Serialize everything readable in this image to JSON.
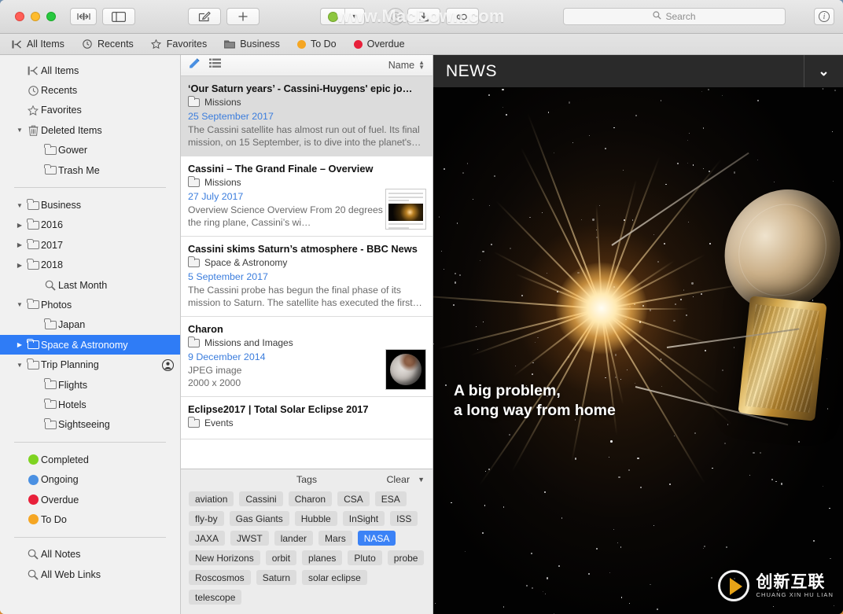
{
  "window": {
    "traffic_lights": [
      "close",
      "minimize",
      "zoom"
    ],
    "toolbar": {
      "sidebar_toggle_label": "›|‹",
      "panes_toggle_label": "▯▯",
      "compose_label": "✎",
      "add_label": "+",
      "status_dot_color": "#8dc63f",
      "status_chevron": "⌄",
      "clock_icon": "clock-icon",
      "download_icon": "download-icon",
      "link_icon": "link-icon",
      "search_placeholder": "Search",
      "info_label": "i"
    },
    "watermark_top": "www.MacDown.com",
    "watermark_logo": {
      "chinese": "创新互联",
      "pinyin": "CHUANG XIN HU LIAN"
    }
  },
  "favorites_bar": [
    {
      "label": "All Items",
      "icon": "all-items-icon",
      "color": null
    },
    {
      "label": "Recents",
      "icon": "clock-icon",
      "color": null
    },
    {
      "label": "Favorites",
      "icon": "star-icon",
      "color": null
    },
    {
      "label": "Business",
      "icon": "folder-icon",
      "color": null
    },
    {
      "label": "To Do",
      "icon": "dot-icon",
      "color": "#f5a623"
    },
    {
      "label": "Overdue",
      "icon": "dot-icon",
      "color": "#e8203a"
    }
  ],
  "sidebar": {
    "groups": [
      {
        "items": [
          {
            "label": "All Items",
            "icon": "all-items-icon",
            "indent": 1,
            "twisty": "",
            "selected": false
          },
          {
            "label": "Recents",
            "icon": "clock-icon",
            "indent": 1,
            "twisty": "",
            "selected": false
          },
          {
            "label": "Favorites",
            "icon": "star-icon",
            "indent": 1,
            "twisty": "",
            "selected": false
          },
          {
            "label": "Deleted Items",
            "icon": "trash-icon",
            "indent": 0,
            "twisty": "▼",
            "selected": false
          },
          {
            "label": "Gower",
            "icon": "folder-icon",
            "indent": 2,
            "twisty": "",
            "selected": false
          },
          {
            "label": "Trash Me",
            "icon": "folder-icon",
            "indent": 2,
            "twisty": "",
            "selected": false
          }
        ]
      },
      {
        "items": [
          {
            "label": "Business",
            "icon": "folder-icon",
            "indent": 0,
            "twisty": "▼",
            "selected": false
          },
          {
            "label": "2016",
            "icon": "folder-icon",
            "indent": 1,
            "twisty": "▶",
            "selected": false
          },
          {
            "label": "2017",
            "icon": "folder-icon",
            "indent": 1,
            "twisty": "▶",
            "selected": false
          },
          {
            "label": "2018",
            "icon": "folder-icon",
            "indent": 1,
            "twisty": "▶",
            "selected": false
          },
          {
            "label": "Last Month",
            "icon": "smart-search-icon",
            "indent": 2,
            "twisty": "",
            "selected": false
          },
          {
            "label": "Photos",
            "icon": "folder-icon",
            "indent": 0,
            "twisty": "▼",
            "selected": false
          },
          {
            "label": "Japan",
            "icon": "folder-icon",
            "indent": 2,
            "twisty": "",
            "selected": false
          },
          {
            "label": "Space & Astronomy",
            "icon": "folder-icon",
            "indent": 0,
            "twisty": "▶",
            "selected": true
          },
          {
            "label": "Trip Planning",
            "icon": "folder-icon",
            "indent": 0,
            "twisty": "▼",
            "selected": false,
            "trailing_icon": "shared-user-icon"
          },
          {
            "label": "Flights",
            "icon": "folder-icon",
            "indent": 2,
            "twisty": "",
            "selected": false
          },
          {
            "label": "Hotels",
            "icon": "folder-icon",
            "indent": 2,
            "twisty": "",
            "selected": false
          },
          {
            "label": "Sightseeing",
            "icon": "folder-icon",
            "indent": 2,
            "twisty": "",
            "selected": false
          }
        ]
      },
      {
        "items": [
          {
            "label": "Completed",
            "icon": "dot-icon",
            "color": "#7ed321",
            "indent": 1,
            "twisty": "",
            "selected": false
          },
          {
            "label": "Ongoing",
            "icon": "dot-icon",
            "color": "#4a90e2",
            "indent": 1,
            "twisty": "",
            "selected": false
          },
          {
            "label": "Overdue",
            "icon": "dot-icon",
            "color": "#e8203a",
            "indent": 1,
            "twisty": "",
            "selected": false
          },
          {
            "label": "To Do",
            "icon": "dot-icon",
            "color": "#f5a623",
            "indent": 1,
            "twisty": "",
            "selected": false
          }
        ]
      },
      {
        "items": [
          {
            "label": "All Notes",
            "icon": "smart-search-icon",
            "indent": 1,
            "twisty": "",
            "selected": false
          },
          {
            "label": "All Web Links",
            "icon": "smart-search-icon",
            "indent": 1,
            "twisty": "",
            "selected": false
          }
        ]
      }
    ]
  },
  "list": {
    "header": {
      "tag_icon": "tag-edit-icon",
      "view_icon": "list-view-icon",
      "sort_label": "Name",
      "sort_icon": "sort-arrows-icon"
    },
    "items": [
      {
        "title": "‘Our Saturn years’ - Cassini-Huygens' epic jo…",
        "location": "Missions",
        "date": "25 September 2017",
        "snippet": "The Cassini satellite has almost run out of fuel. Its final mission, on 15 September, is to dive into the planet's…",
        "selected": true,
        "thumb": "none"
      },
      {
        "title": "Cassini – The Grand Finale – Overview",
        "location": "Missions",
        "date": "27 July 2017",
        "snippet": "Overview Science Overview From 20 degrees above the ring plane, Cassini’s wi…",
        "selected": false,
        "thumb": "document"
      },
      {
        "title": "Cassini skims Saturn’s atmosphere - BBC News",
        "location": "Space & Astronomy",
        "date": "5 September 2017",
        "snippet": "The Cassini probe has begun the final phase of its mission to Saturn. The satellite has executed the first…",
        "selected": false,
        "thumb": "none"
      },
      {
        "title": "Charon",
        "location": "Missions and Images",
        "date": "9 December 2014",
        "meta_type": "JPEG image",
        "meta_size": "2000 x 2000",
        "selected": false,
        "thumb": "image"
      },
      {
        "title": "Eclipse2017 | Total Solar Eclipse 2017",
        "location": "Events",
        "selected": false,
        "thumb": "none"
      }
    ]
  },
  "tags_panel": {
    "title": "Tags",
    "clear_label": "Clear",
    "collapse_icon": "chevron-down-icon",
    "tags": [
      {
        "label": "aviation",
        "selected": false
      },
      {
        "label": "Cassini",
        "selected": false
      },
      {
        "label": "Charon",
        "selected": false
      },
      {
        "label": "CSA",
        "selected": false
      },
      {
        "label": "ESA",
        "selected": false
      },
      {
        "label": "fly-by",
        "selected": false
      },
      {
        "label": "Gas Giants",
        "selected": false
      },
      {
        "label": "Hubble",
        "selected": false
      },
      {
        "label": "InSight",
        "selected": false
      },
      {
        "label": "ISS",
        "selected": false
      },
      {
        "label": "JAXA",
        "selected": false
      },
      {
        "label": "JWST",
        "selected": false
      },
      {
        "label": "lander",
        "selected": false
      },
      {
        "label": "Mars",
        "selected": false
      },
      {
        "label": "NASA",
        "selected": true
      },
      {
        "label": "New Horizons",
        "selected": false
      },
      {
        "label": "orbit",
        "selected": false
      },
      {
        "label": "planes",
        "selected": false
      },
      {
        "label": "Pluto",
        "selected": false
      },
      {
        "label": "probe",
        "selected": false
      },
      {
        "label": "Roscosmos",
        "selected": false
      },
      {
        "label": "Saturn",
        "selected": false
      },
      {
        "label": "solar eclipse",
        "selected": false
      },
      {
        "label": "telescope",
        "selected": false
      }
    ]
  },
  "preview": {
    "brand": "NEWS",
    "collapse_icon": "chevron-down-icon",
    "headline_line1": "A big problem,",
    "headline_line2": "a long way from home",
    "cursor_icon": "open-hand-cursor"
  }
}
